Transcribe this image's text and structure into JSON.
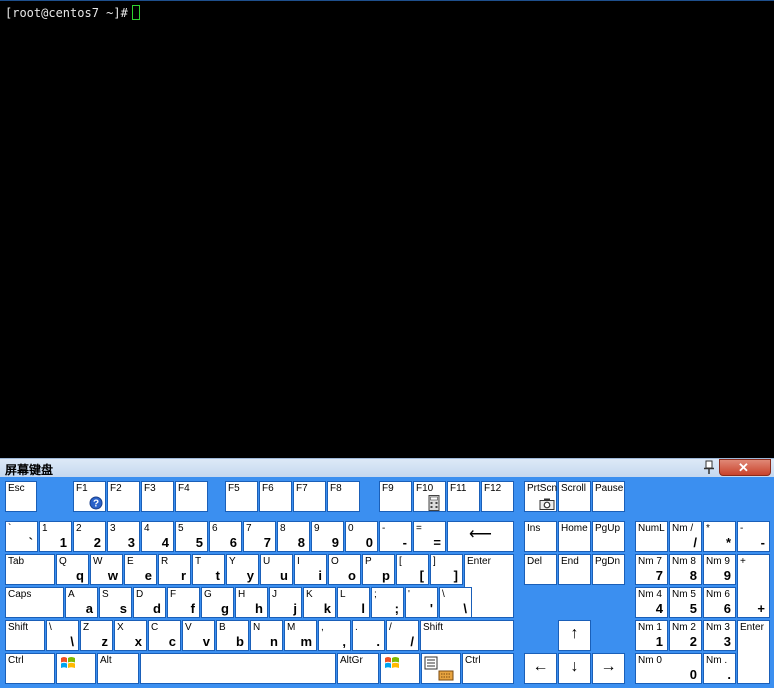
{
  "terminal": {
    "prompt": "[root@centos7 ~]#"
  },
  "osk": {
    "title": "屏幕键盘",
    "close_label": "✕",
    "keys": [
      {
        "id": "esc",
        "t": "Esc",
        "b": ""
      },
      {
        "id": "f1",
        "t": "F1",
        "b": ""
      },
      {
        "id": "f2",
        "t": "F2",
        "b": ""
      },
      {
        "id": "f3",
        "t": "F3",
        "b": ""
      },
      {
        "id": "f4",
        "t": "F4",
        "b": ""
      },
      {
        "id": "f5",
        "t": "F5",
        "b": ""
      },
      {
        "id": "f6",
        "t": "F6",
        "b": ""
      },
      {
        "id": "f7",
        "t": "F7",
        "b": ""
      },
      {
        "id": "f8",
        "t": "F8",
        "b": ""
      },
      {
        "id": "f9",
        "t": "F9",
        "b": ""
      },
      {
        "id": "f10",
        "t": "F10",
        "b": ""
      },
      {
        "id": "f11",
        "t": "F11",
        "b": ""
      },
      {
        "id": "f12",
        "t": "F12",
        "b": ""
      },
      {
        "id": "prtsc",
        "t": "PrtScn",
        "b": ""
      },
      {
        "id": "scroll",
        "t": "Scroll",
        "b": ""
      },
      {
        "id": "pause",
        "t": "Pause",
        "b": ""
      },
      {
        "id": "backtick",
        "t": "`",
        "b": "`"
      },
      {
        "id": "d1",
        "t": "1",
        "b": "1"
      },
      {
        "id": "d2",
        "t": "2",
        "b": "2"
      },
      {
        "id": "d3",
        "t": "3",
        "b": "3"
      },
      {
        "id": "d4",
        "t": "4",
        "b": "4"
      },
      {
        "id": "d5",
        "t": "5",
        "b": "5"
      },
      {
        "id": "d6",
        "t": "6",
        "b": "6"
      },
      {
        "id": "d7",
        "t": "7",
        "b": "7"
      },
      {
        "id": "d8",
        "t": "8",
        "b": "8"
      },
      {
        "id": "d9",
        "t": "9",
        "b": "9"
      },
      {
        "id": "d0",
        "t": "0",
        "b": "0"
      },
      {
        "id": "minus",
        "t": "-",
        "b": "-"
      },
      {
        "id": "equals",
        "t": "=",
        "b": "="
      },
      {
        "id": "backspace",
        "t": "",
        "b": "",
        "big": "⟵"
      },
      {
        "id": "ins",
        "t": "Ins",
        "b": ""
      },
      {
        "id": "home",
        "t": "Home",
        "b": ""
      },
      {
        "id": "pgup",
        "t": "PgUp",
        "b": ""
      },
      {
        "id": "numlock",
        "t": "NumL",
        "b": ""
      },
      {
        "id": "npdiv",
        "t": "Nm /",
        "b": "/"
      },
      {
        "id": "npmul",
        "t": "*",
        "b": "*"
      },
      {
        "id": "npsub",
        "t": "-",
        "b": "-"
      },
      {
        "id": "tab",
        "t": "Tab",
        "b": ""
      },
      {
        "id": "q",
        "t": "Q",
        "b": "q"
      },
      {
        "id": "w",
        "t": "W",
        "b": "w"
      },
      {
        "id": "e",
        "t": "E",
        "b": "e"
      },
      {
        "id": "r",
        "t": "R",
        "b": "r"
      },
      {
        "id": "tk",
        "t": "T",
        "b": "t"
      },
      {
        "id": "y",
        "t": "Y",
        "b": "y"
      },
      {
        "id": "u",
        "t": "U",
        "b": "u"
      },
      {
        "id": "i",
        "t": "I",
        "b": "i"
      },
      {
        "id": "o",
        "t": "O",
        "b": "o"
      },
      {
        "id": "p",
        "t": "P",
        "b": "p"
      },
      {
        "id": "lbr",
        "t": "[",
        "b": "["
      },
      {
        "id": "rbr",
        "t": "]",
        "b": "]"
      },
      {
        "id": "enter",
        "t": "Enter",
        "b": ""
      },
      {
        "id": "del",
        "t": "Del",
        "b": ""
      },
      {
        "id": "end",
        "t": "End",
        "b": ""
      },
      {
        "id": "pgdn",
        "t": "PgDn",
        "b": ""
      },
      {
        "id": "np7",
        "t": "Nm 7",
        "b": "7"
      },
      {
        "id": "np8",
        "t": "Nm 8",
        "b": "8"
      },
      {
        "id": "np9",
        "t": "Nm 9",
        "b": "9"
      },
      {
        "id": "npadd",
        "t": "+",
        "b": "+"
      },
      {
        "id": "caps",
        "t": "Caps",
        "b": ""
      },
      {
        "id": "a",
        "t": "A",
        "b": "a"
      },
      {
        "id": "s",
        "t": "S",
        "b": "s"
      },
      {
        "id": "d",
        "t": "D",
        "b": "d"
      },
      {
        "id": "f",
        "t": "F",
        "b": "f"
      },
      {
        "id": "g",
        "t": "G",
        "b": "g"
      },
      {
        "id": "h",
        "t": "H",
        "b": "h"
      },
      {
        "id": "j",
        "t": "J",
        "b": "j"
      },
      {
        "id": "k",
        "t": "K",
        "b": "k"
      },
      {
        "id": "l",
        "t": "L",
        "b": "l"
      },
      {
        "id": "semi",
        "t": ";",
        "b": ";"
      },
      {
        "id": "quote",
        "t": "'",
        "b": "'"
      },
      {
        "id": "bslash",
        "t": "\\",
        "b": "\\"
      },
      {
        "id": "np4",
        "t": "Nm 4",
        "b": "4"
      },
      {
        "id": "np5",
        "t": "Nm 5",
        "b": "5"
      },
      {
        "id": "np6",
        "t": "Nm 6",
        "b": "6"
      },
      {
        "id": "lshift",
        "t": "Shift",
        "b": ""
      },
      {
        "id": "oem102",
        "t": "\\",
        "b": "\\"
      },
      {
        "id": "z",
        "t": "Z",
        "b": "z"
      },
      {
        "id": "x",
        "t": "X",
        "b": "x"
      },
      {
        "id": "c",
        "t": "C",
        "b": "c"
      },
      {
        "id": "v",
        "t": "V",
        "b": "v"
      },
      {
        "id": "bk",
        "t": "B",
        "b": "b"
      },
      {
        "id": "n",
        "t": "N",
        "b": "n"
      },
      {
        "id": "m",
        "t": "M",
        "b": "m"
      },
      {
        "id": "comma",
        "t": ",",
        "b": ","
      },
      {
        "id": "period",
        "t": ".",
        "b": "."
      },
      {
        "id": "slash",
        "t": "/",
        "b": "/"
      },
      {
        "id": "rshift",
        "t": "Shift",
        "b": ""
      },
      {
        "id": "up",
        "t": "",
        "b": "",
        "big": "↑"
      },
      {
        "id": "np1",
        "t": "Nm 1",
        "b": "1"
      },
      {
        "id": "np2",
        "t": "Nm 2",
        "b": "2"
      },
      {
        "id": "np3",
        "t": "Nm 3",
        "b": "3"
      },
      {
        "id": "npenter",
        "t": "Enter",
        "b": ""
      },
      {
        "id": "lctrl",
        "t": "Ctrl",
        "b": ""
      },
      {
        "id": "lwin",
        "t": "",
        "b": ""
      },
      {
        "id": "lalt",
        "t": "Alt",
        "b": ""
      },
      {
        "id": "space",
        "t": "",
        "b": ""
      },
      {
        "id": "altgr",
        "t": "AltGr",
        "b": ""
      },
      {
        "id": "rwin",
        "t": "",
        "b": ""
      },
      {
        "id": "menu",
        "t": "",
        "b": ""
      },
      {
        "id": "rctrl",
        "t": "Ctrl",
        "b": ""
      },
      {
        "id": "left",
        "t": "",
        "b": "",
        "big": "←"
      },
      {
        "id": "down",
        "t": "",
        "b": "",
        "big": "↓"
      },
      {
        "id": "right",
        "t": "",
        "b": "",
        "big": "→"
      },
      {
        "id": "np0",
        "t": "Nm 0",
        "b": "0"
      },
      {
        "id": "npdot",
        "t": "Nm .",
        "b": "."
      }
    ]
  }
}
